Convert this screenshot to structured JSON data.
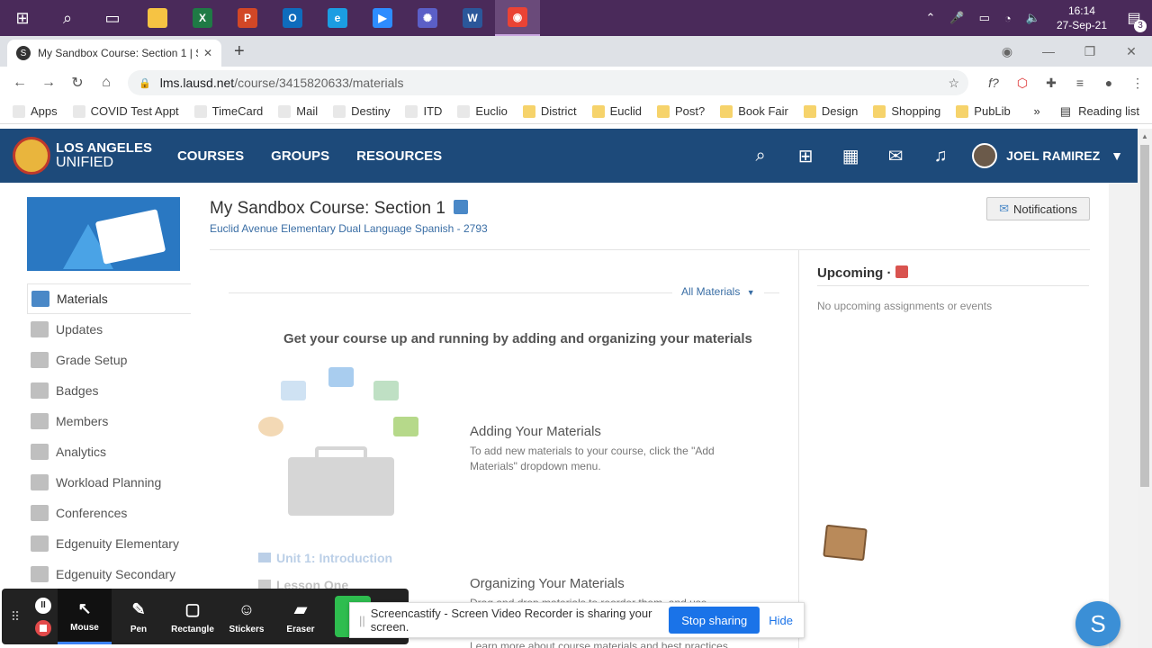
{
  "taskbar": {
    "apps": [
      {
        "name": "file-explorer",
        "label": "",
        "color": "#f6c343"
      },
      {
        "name": "excel",
        "label": "X",
        "color": "#1f7a45"
      },
      {
        "name": "powerpoint",
        "label": "P",
        "color": "#d24726"
      },
      {
        "name": "outlook",
        "label": "O",
        "color": "#0f6cbd"
      },
      {
        "name": "edge",
        "label": "e",
        "color": "#1b9de2"
      },
      {
        "name": "zoom",
        "label": "▶",
        "color": "#2d8cff"
      },
      {
        "name": "app-gear",
        "label": "✺",
        "color": "#5b5fc7"
      },
      {
        "name": "word",
        "label": "W",
        "color": "#2b579a"
      },
      {
        "name": "chrome",
        "label": "◉",
        "color": "#ea4335"
      }
    ],
    "time": "16:14",
    "date": "27-Sep-21",
    "notification_count": "3"
  },
  "browser": {
    "tab_title": "My Sandbox Course: Section 1 | S",
    "url_host": "lms.lausd.net",
    "url_path": "/course/3415820633/materials",
    "bookmarks": [
      {
        "label": "Apps",
        "icon": "apps-grid"
      },
      {
        "label": "COVID Test Appt",
        "icon": "covid"
      },
      {
        "label": "TimeCard",
        "icon": "timecard"
      },
      {
        "label": "Mail",
        "icon": "microsoft"
      },
      {
        "label": "Destiny",
        "icon": "destiny"
      },
      {
        "label": "ITD",
        "icon": "itd"
      },
      {
        "label": "Euclio",
        "icon": "trello"
      },
      {
        "label": "District",
        "icon": "folder"
      },
      {
        "label": "Euclid",
        "icon": "folder"
      },
      {
        "label": "Post?",
        "icon": "folder"
      },
      {
        "label": "Book Fair",
        "icon": "folder"
      },
      {
        "label": "Design",
        "icon": "folder"
      },
      {
        "label": "Shopping",
        "icon": "folder"
      },
      {
        "label": "PubLib",
        "icon": "folder"
      }
    ],
    "more": "»",
    "reading_list": "Reading list"
  },
  "site": {
    "logo_line1": "LOS ANGELES",
    "logo_line2": "UNIFIED",
    "nav": [
      "COURSES",
      "GROUPS",
      "RESOURCES"
    ],
    "user": "JOEL RAMIREZ"
  },
  "course": {
    "title": "My Sandbox Course: Section 1",
    "subtitle": "Euclid Avenue Elementary Dual Language Spanish - 2793",
    "notifications_label": "Notifications",
    "menu": [
      "Materials",
      "Updates",
      "Grade Setup",
      "Badges",
      "Members",
      "Analytics",
      "Workload Planning",
      "Conferences",
      "Edgenuity Elementary",
      "Edgenuity Secondary"
    ],
    "all_materials": "All Materials",
    "get_started": "Get your course up and running by adding and organizing your materials",
    "adding_title": "Adding Your Materials",
    "adding_text": "To add new materials to your course, click the \"Add Materials\" dropdown menu.",
    "unit_label": "Unit 1: Introduction",
    "lesson_label": "Lesson One",
    "organizing_title": "Organizing Your Materials",
    "organizing_text": "Drag and drop materials to reorder them, and use",
    "learn_more": "Learn more about course materials and best practices",
    "upcoming_label": "Upcoming",
    "upcoming_sep": "·",
    "no_upcoming": "No upcoming assignments or events"
  },
  "screencastify": {
    "tools": [
      {
        "label": "Mouse",
        "icon": "↖"
      },
      {
        "label": "Pen",
        "icon": "✎"
      },
      {
        "label": "Rectangle",
        "icon": "▢"
      },
      {
        "label": "Stickers",
        "icon": "☺"
      },
      {
        "label": "Eraser",
        "icon": "▰"
      }
    ],
    "share_message": "Screencastify - Screen Video Recorder is sharing your screen.",
    "stop_sharing": "Stop sharing",
    "hide": "Hide"
  },
  "fab_letter": "S"
}
